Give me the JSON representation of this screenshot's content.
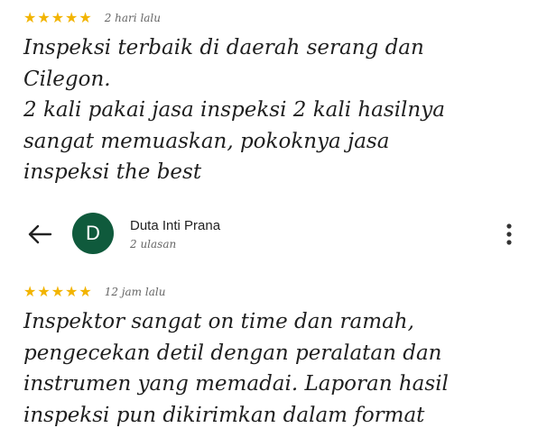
{
  "review_1": {
    "rating": 5,
    "time_ago": "2 hari lalu",
    "text": "Inspeksi terbaik di daerah serang dan\nCilegon.\n2 kali pakai jasa inspeksi 2 kali hasilnya\nsangat memuaskan, pokoknya jasa\ninspeksi the best"
  },
  "reviewer": {
    "avatar_letter": "D",
    "name": "Duta Inti Prana",
    "review_count": "2 ulasan",
    "avatar_color": "#0f5a3c",
    "back_icon": "arrow-left-icon",
    "menu_icon": "more-vertical-icon"
  },
  "review_2": {
    "rating": 5,
    "time_ago": "12 jam lalu",
    "text": "Inspektor sangat on time dan ramah,\npengecekan detil dengan peralatan dan\ninstrumen yang memadai. Laporan hasil\ninspeksi pun dikirimkan dalam format"
  },
  "colors": {
    "star": "#f2b400",
    "text": "#1f1f1f",
    "muted": "#666666"
  }
}
